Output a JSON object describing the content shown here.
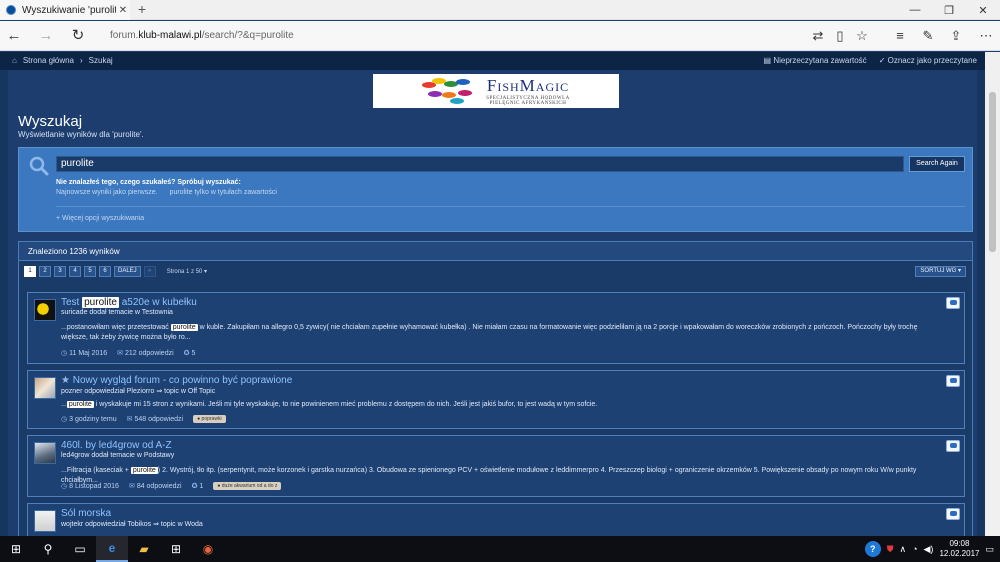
{
  "browser": {
    "tab_title": "Wyszukiwanie 'purolite'",
    "tab_close": "✕",
    "new_tab": "+",
    "url_prefix": "forum.",
    "url_domain": "klub-malawi.pl",
    "url_path": "/search/?&q=purolite"
  },
  "topnav": {
    "home": "Strona główna",
    "separator": "›",
    "current": "Szukaj",
    "unread": "Nieprzeczytana zawartość",
    "mark_read": "Oznacz jako przeczytane"
  },
  "banner": {
    "brand": "FishMagic",
    "subtitle_1": "SPECJALISTYCZNA HODOWLA",
    "subtitle_2": "PIELĘGNIC AFRYKAŃSKICH"
  },
  "heading": {
    "title": "Wyszukaj",
    "subtitle": "Wyświetlanie wyników dla 'purolite'."
  },
  "search": {
    "value": "purolite",
    "button": "Search Again",
    "hint": "Nie znalazłeś tego, czego szukałeś? Spróbuj wyszukać:",
    "link_newest": "Najnowsze wyniki jako pierwsze.",
    "link_titles": "purolite tylko w tytułach zawartości",
    "more_options": "Więcej opcji wyszukiwania"
  },
  "results": {
    "count_label": "Znaleziono 1236 wyników",
    "pages": [
      "1",
      "2",
      "3",
      "4",
      "5",
      "6"
    ],
    "next": "DALEJ",
    "last": "»",
    "page_of": "Strona 1 z 50",
    "sort": "SORTUJ WG"
  },
  "items": [
    {
      "title_pre": "Test ",
      "title_hl": "purolite",
      "title_post": " a520e w kubełku",
      "meta": "suricade dodał temacie w Testownia",
      "snippet_pre": "...postanowiłam więc przetestować ",
      "snippet_hl": "purolite",
      "snippet_post": " w kuble. Zakupiłam na allegro 0,5 zywicy( nie chciałam zupełnie wyhamować kubełka) . Nie miałam czasu na formatowanie więc podzieliłam ją na 2 porcje i wpakowałam do woreczków zrobionych z pończoch. Pończochy były trochę większe, tak żeby żywicę można było ro...",
      "date": "11 Maj 2016",
      "replies": "212 odpowiedzi",
      "reactions": "5",
      "tag": ""
    },
    {
      "title_pre": "Nowy wygląd forum - co powinno być poprawione",
      "title_hl": "",
      "title_post": "",
      "meta": "pozner odpowiedział Pleziorro ⇒ topic w Off Topic",
      "snippet_pre": "...",
      "snippet_hl": "purolite",
      "snippet_post": " i wyskakuje mi 15 stron z wynikami. Jeśli mi tyle wyskakuje, to nie powinienem mieć problemu z dostępem do nich. Jeśli jest jakiś bufor, to jest wadą w tym sofcie.",
      "date": "3 godziny temu",
      "replies": "548 odpowiedzi",
      "reactions": "",
      "tag": "poprawki"
    },
    {
      "title_pre": "460l. by led4grow od A-Z",
      "title_hl": "",
      "title_post": "",
      "meta": "led4grow dodał temacie w Podstawy",
      "snippet_pre": "...Filtracja (kaseciak + ",
      "snippet_hl": "purolite",
      "snippet_post": ") 2. Wystrój, tło itp. (serpentynit, może korzonek i garstka nurzańca) 3. Obudowa ze spienionego PCV + oświetlenie modułowe z leddimmerpro 4. Przeszczep biologi + ograniczenie okrzemków 5. Powiększenie obsady po nowym roku W/w punkty chciałbym...",
      "date": "8 Listopad 2016",
      "replies": "84 odpowiedzi",
      "reactions": "1",
      "tag": "duże akwarium od a do z"
    },
    {
      "title_pre": "Sól morska",
      "title_hl": "",
      "title_post": "",
      "meta": "wojtekr odpowiedział Tobikos ⇒ topic w Woda",
      "snippet_pre": "",
      "snippet_hl": "",
      "snippet_post": "",
      "date": "",
      "replies": "",
      "reactions": "",
      "tag": ""
    }
  ],
  "taskbar": {
    "time": "09:08",
    "date": "12.02.2017"
  },
  "colors": {
    "accent": "#3b78c0",
    "page_bg": "#16355f",
    "link": "#8fc3ff"
  }
}
